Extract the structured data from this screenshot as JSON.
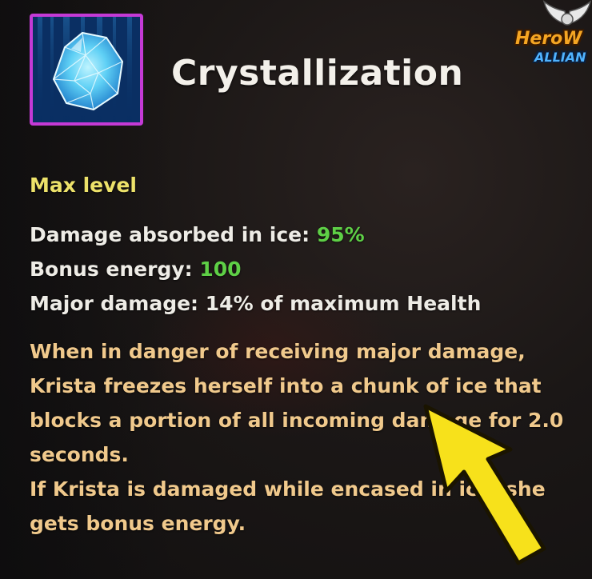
{
  "skill": {
    "title": "Crystallization",
    "icon": "ice-crystal-icon",
    "frame_color": "#c43ad6"
  },
  "logo": {
    "line1": "HeroW",
    "line2": "ALLIAN"
  },
  "level_label": "Max level",
  "stats": [
    {
      "label": "Damage absorbed in ice:",
      "value": "95%"
    },
    {
      "label": "Bonus energy:",
      "value": "100"
    },
    {
      "label": "Major damage:",
      "value": "14% of maximum Health"
    }
  ],
  "description": {
    "paragraph1": "When in danger of receiving major damage, Krista freezes herself into a chunk of ice that blocks a portion of all incoming damage for 2.0 seconds.",
    "paragraph2": "If Krista is damaged while encased in ice, she gets bonus energy."
  },
  "colors": {
    "max_level": "#ede26a",
    "stat_value": "#5ecf46",
    "description": "#f0c98c",
    "arrow": "#f7e11b"
  }
}
